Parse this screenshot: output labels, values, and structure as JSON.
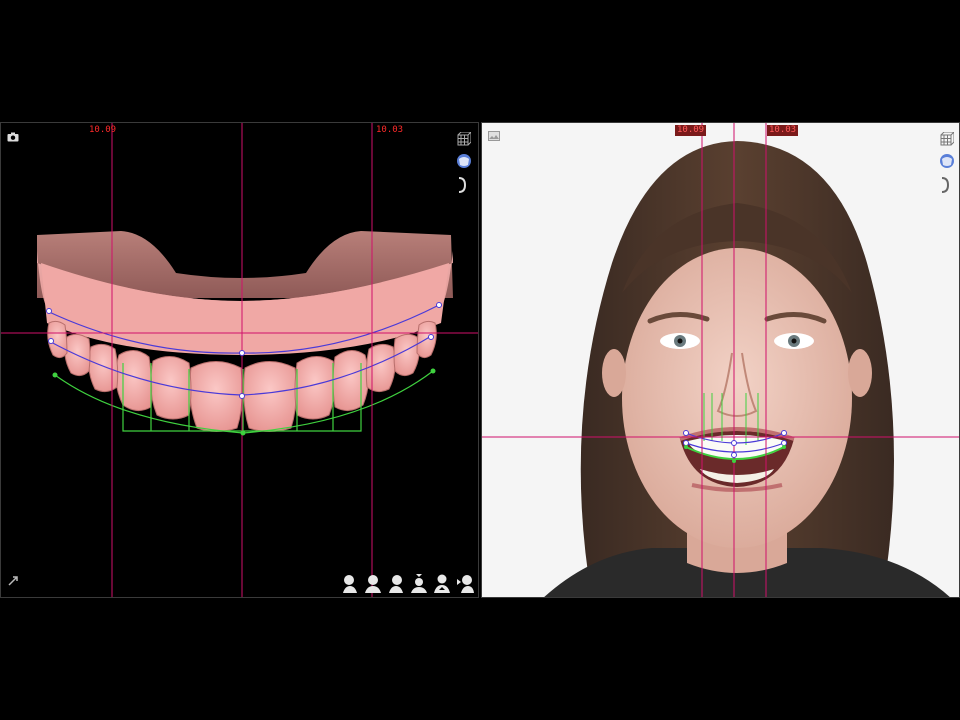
{
  "left_panel": {
    "measure_left": "10.09",
    "measure_right": "10.03",
    "icons": [
      "camera-icon",
      "cube-grid-icon",
      "tooth-model-icon",
      "bracket-icon",
      "expand-arrow-icon"
    ],
    "view_buttons": [
      "view-face-left-icon",
      "view-face-front-icon",
      "view-face-right-icon",
      "view-face-top-icon",
      "view-face-bottom-icon",
      "view-face-profile-icon"
    ]
  },
  "right_panel": {
    "measure_left": "10.09",
    "measure_right": "10.03",
    "icons": [
      "image-icon",
      "cube-grid-icon",
      "tooth-model-icon",
      "bracket-icon"
    ]
  },
  "colors": {
    "background": "#000000",
    "reference_line": "#d0106a",
    "arch_curve": "#4a3ad8",
    "outline": "#3fd13f",
    "model_pink": "#f1a7a7",
    "model_base": "#a86e6a",
    "measure_text": "#ff2a2a"
  }
}
